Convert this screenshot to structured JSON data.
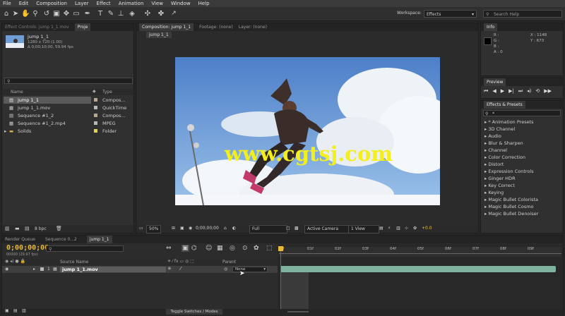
{
  "menu": [
    "File",
    "Edit",
    "Composition",
    "Layer",
    "Effect",
    "Animation",
    "View",
    "Window",
    "Help"
  ],
  "toolbar": {
    "workspace_label": "Workspace:",
    "workspace_value": "Effects",
    "search_placeholder": "Search Help"
  },
  "project_panel": {
    "tab_effect_controls": "Effect Controls: jump 1_1.mov",
    "tab_project": "Proje",
    "selected_name": "jump 1_1",
    "selected_info1": "1280 x 720 (1.00)",
    "selected_info2": "Δ 0;00;10;00, 59.94 fps",
    "col_name": "Name",
    "col_type": "Type",
    "bpc": "8 bpc",
    "items": [
      {
        "name": "jump 1_1",
        "type": "Compos...",
        "color": "#b7a98a"
      },
      {
        "name": "jump 1_1.mov",
        "type": "QuickTime",
        "color": "#b7b7b7"
      },
      {
        "name": "Sequence #1_2",
        "type": "Compos...",
        "color": "#b7a98a"
      },
      {
        "name": "Sequence #1_2.mp4",
        "type": "MPEG",
        "color": "#b7b7b7"
      },
      {
        "name": "Solids",
        "type": "Folder",
        "color": "#e3d44a"
      }
    ]
  },
  "viewer": {
    "tab_composition": "Composition: jump 1_1",
    "tab_footage": "Footage: (none)",
    "tab_layer": "Layer: (none)",
    "comp_button": "jump 1_1",
    "zoom": "50%",
    "timecode": "0;00;00;00",
    "resolution": "Full",
    "camera": "Active Camera",
    "views": "1 View",
    "offset": "+0.0",
    "watermark": "www.cgtsj.com"
  },
  "info_panel": {
    "tab": "Info",
    "labels": [
      "R :",
      "G :",
      "B :",
      "A : 0"
    ],
    "x": "X : 1148",
    "y": "Y : 673"
  },
  "preview_panel": {
    "tab": "Preview"
  },
  "effects_panel": {
    "tab": "Effects & Presets",
    "search_value": "*",
    "items": [
      "* Animation Presets",
      "3D Channel",
      "Audio",
      "Blur & Sharpen",
      "Channel",
      "Color Correction",
      "Distort",
      "Expression Controls",
      "Ginger HDR",
      "Key Correct",
      "Keying",
      "Magic Bullet Colorista",
      "Magic Bullet Cosmo",
      "Magic Bullet Denoiser"
    ]
  },
  "timeline": {
    "tab_render": "Render Queue",
    "tab_seq": "Sequence 0...2",
    "tab_comp": "jump 1_1",
    "timecode": "0;00;00;00",
    "fps_info": "00000 (29.97 fps)",
    "col_source": "Source Name",
    "col_parent": "Parent",
    "layer_index": "1",
    "layer_name": "jump 1_1.mov",
    "parent_value": "None",
    "toggle_label": "Toggle Switches / Modes",
    "ticks": [
      "0f",
      "01f",
      "02f",
      "03f",
      "04f",
      "05f",
      "06f",
      "07f",
      "08f",
      "09f"
    ]
  }
}
